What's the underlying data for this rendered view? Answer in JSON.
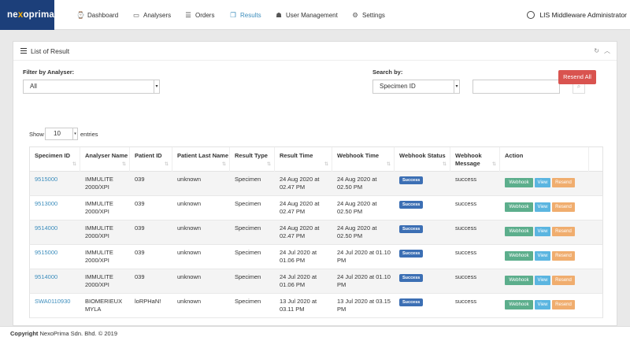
{
  "brand": {
    "prefix": "ne",
    "x": "x",
    "suffix": "oprima"
  },
  "nav": [
    {
      "icon": "dashboard-icon",
      "glyph": "⌚",
      "label": "Dashboard"
    },
    {
      "icon": "monitor-icon",
      "glyph": "▭",
      "label": "Analysers"
    },
    {
      "icon": "list-icon",
      "glyph": "☰",
      "label": "Orders"
    },
    {
      "icon": "document-icon",
      "glyph": "❐",
      "label": "Results"
    },
    {
      "icon": "users-icon",
      "glyph": "☗",
      "label": "User Management"
    },
    {
      "icon": "gears-icon",
      "glyph": "⚙",
      "label": "Settings"
    }
  ],
  "user": {
    "name": "LIS Middleware Administrator"
  },
  "panel": {
    "title": "List of Result",
    "filter_label": "Filter by Analyser:",
    "filter_value": "All",
    "search_label": "Search by:",
    "search_by_value": "Specimen ID",
    "search_value": "",
    "resend_all": "Resend All",
    "show": "Show",
    "entries_value": "10",
    "entries": "entries"
  },
  "table": {
    "headers": [
      "Specimen ID",
      "Analyser Name",
      "Patient ID",
      "Patient Last Name",
      "Result Type",
      "Result Time",
      "Webhook Time",
      "Webhook Status",
      "Webhook Message",
      "Action"
    ],
    "actions": {
      "webhook": "Webhook",
      "view": "View",
      "resend": "Resend"
    },
    "rows": [
      {
        "specimen": "9515000",
        "analyser": "IMMULITE 2000/XPI",
        "patient_id": "039",
        "last_name": "unknown",
        "type": "Specimen",
        "result_time": "24 Aug 2020 at 02.47 PM",
        "webhook_time": "24 Aug 2020 at 02.50 PM",
        "status": "Success",
        "message": "success"
      },
      {
        "specimen": "9513000",
        "analyser": "IMMULITE 2000/XPI",
        "patient_id": "039",
        "last_name": "unknown",
        "type": "Specimen",
        "result_time": "24 Aug 2020 at 02.47 PM",
        "webhook_time": "24 Aug 2020 at 02.50 PM",
        "status": "Success",
        "message": "success"
      },
      {
        "specimen": "9514000",
        "analyser": "IMMULITE 2000/XPI",
        "patient_id": "039",
        "last_name": "unknown",
        "type": "Specimen",
        "result_time": "24 Aug 2020 at 02.47 PM",
        "webhook_time": "24 Aug 2020 at 02.50 PM",
        "status": "Success",
        "message": "success"
      },
      {
        "specimen": "9515000",
        "analyser": "IMMULITE 2000/XPI",
        "patient_id": "039",
        "last_name": "unknown",
        "type": "Specimen",
        "result_time": "24 Jul 2020 at 01.06 PM",
        "webhook_time": "24 Jul 2020 at 01.10 PM",
        "status": "Success",
        "message": "success"
      },
      {
        "specimen": "9514000",
        "analyser": "IMMULITE 2000/XPI",
        "patient_id": "039",
        "last_name": "unknown",
        "type": "Specimen",
        "result_time": "24 Jul 2020 at 01.06 PM",
        "webhook_time": "24 Jul 2020 at 01.10 PM",
        "status": "Success",
        "message": "success"
      },
      {
        "specimen": "SWA0110930",
        "analyser": "BIOMERIEUX MYLA",
        "patient_id": "loRPHaN!",
        "last_name": "unknown",
        "type": "Specimen",
        "result_time": "13 Jul 2020 at 03.11 PM",
        "webhook_time": "13 Jul 2020 at 03.15 PM",
        "status": "Success",
        "message": "success"
      }
    ]
  },
  "footer": {
    "bold": "Copyright",
    "text": " NexoPrima Sdn. Bhd. © 2019"
  }
}
